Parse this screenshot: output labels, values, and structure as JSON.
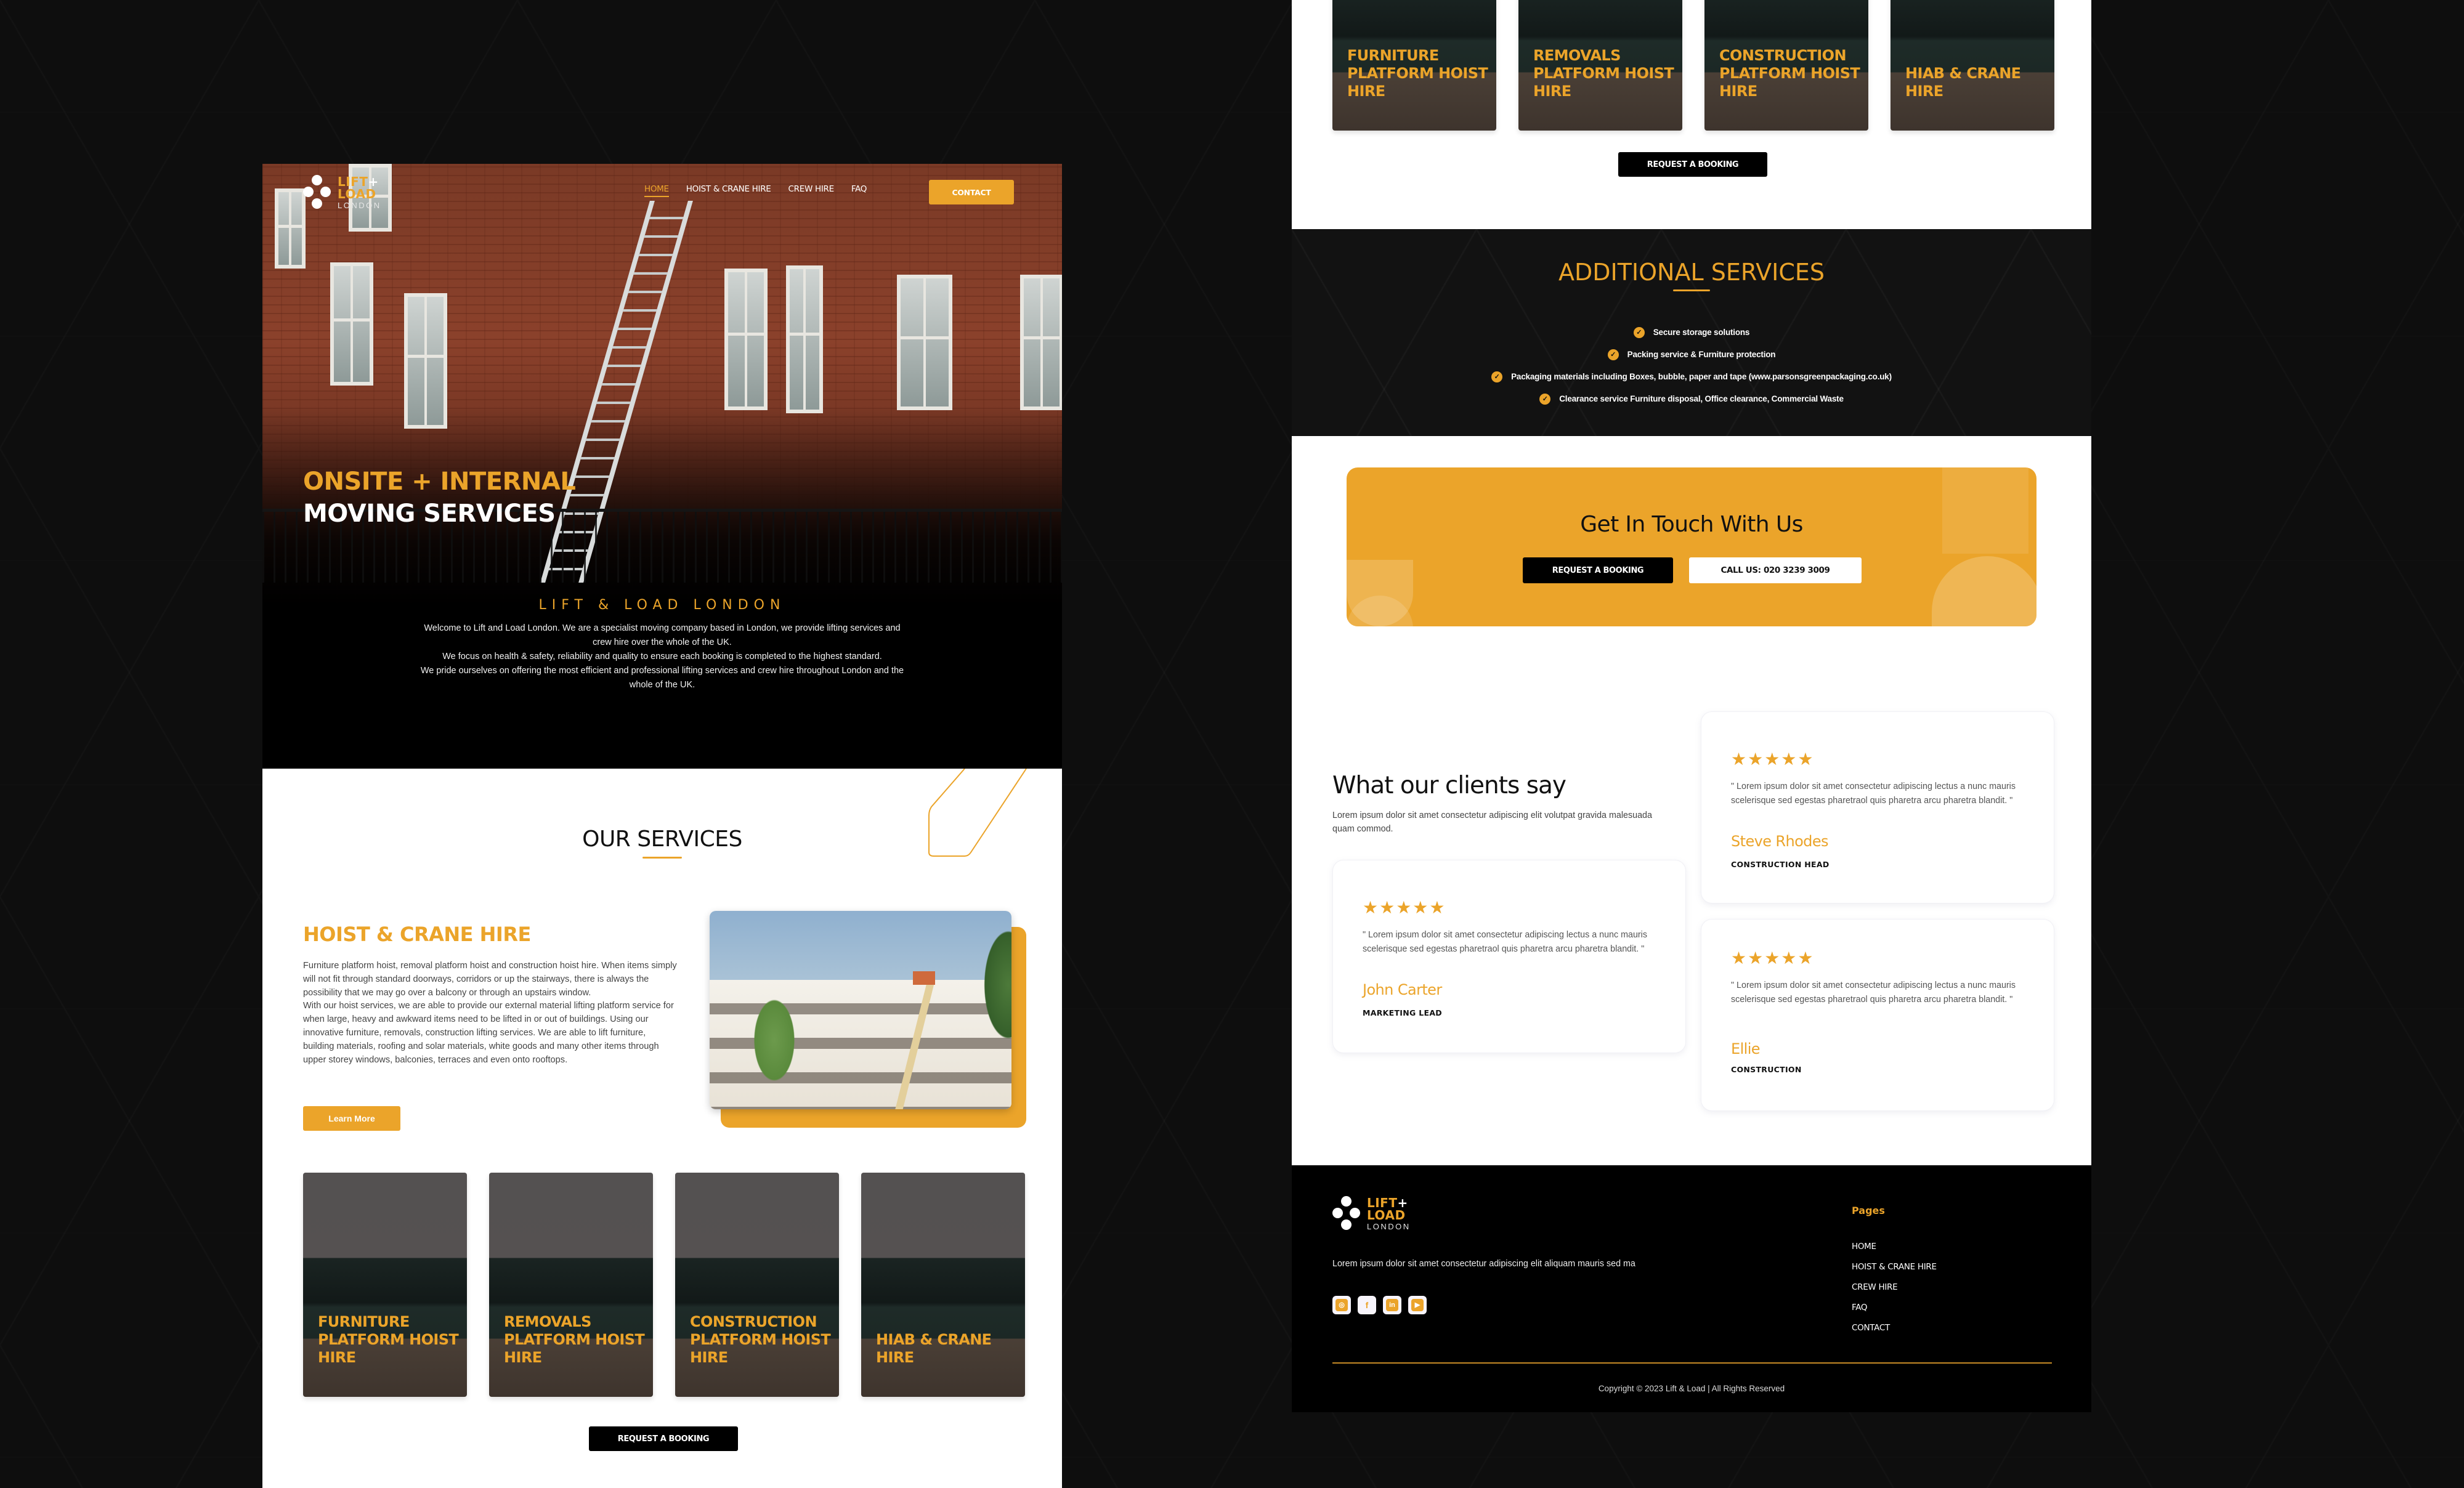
{
  "brand": {
    "logo_line1": "LIFT",
    "logo_plus": "+",
    "logo_line2": "LOAD",
    "logo_line3": "LONDON",
    "accent_color": "#eba42a"
  },
  "nav": {
    "items": [
      {
        "label": "HOME",
        "active": true
      },
      {
        "label": "HOIST & CRANE HIRE",
        "active": false
      },
      {
        "label": "CREW HIRE",
        "active": false
      },
      {
        "label": "FAQ",
        "active": false
      }
    ],
    "contact_label": "CONTACT"
  },
  "hero": {
    "title_line1": "ONSITE + INTERNAL",
    "title_line2": "MOVING SERVICES"
  },
  "intro": {
    "kicker": "LIFT & LOAD LONDON",
    "paragraphs": [
      "Welcome to Lift and Load London. We are a specialist moving company based in London, we provide lifting services and crew hire over the whole of the UK.",
      "We focus on health & safety, reliability and quality to ensure each booking is completed to the highest standard.",
      "We pride ourselves on offering the most efficient and professional lifting services and crew hire throughout London and the whole of the UK."
    ]
  },
  "services": {
    "title": "OUR SERVICES",
    "hoist": {
      "title": "HOIST & CRANE HIRE",
      "paragraphs": [
        "Furniture platform hoist, removal platform hoist and construction hoist hire. When items simply will not fit through standard doorways, corridors or up the stairways, there is always the possibility that we may go over a balcony or through an upstairs window.",
        "With our hoist services, we are able to provide our external material lifting platform service for when large, heavy and awkward items need to be lifted in or out of buildings. Using our innovative furniture, removals, construction lifting services. We are able to lift furniture, building materials, roofing and solar materials, white goods and many other items through upper storey windows, balconies, terraces and even onto rooftops."
      ],
      "learn_more_label": "Learn More"
    },
    "cards": [
      {
        "label": "FURNITURE PLATFORM HOIST HIRE"
      },
      {
        "label": "REMOVALS PLATFORM HOIST HIRE"
      },
      {
        "label": "CONSTRUCTION PLATFORM HOIST HIRE"
      },
      {
        "label": "HIAB & CRANE HIRE"
      }
    ],
    "booking_label": "REQUEST A BOOKING"
  },
  "additional": {
    "title": "ADDITIONAL SERVICES",
    "items": [
      "Secure storage solutions",
      "Packing service & Furniture protection",
      "Packaging materials including Boxes, bubble, paper and tape (www.parsonsgreenpackaging.co.uk)",
      "Clearance service Furniture disposal, Office clearance, Commercial Waste"
    ]
  },
  "cta": {
    "title": "Get In Touch With Us",
    "booking_label": "REQUEST A BOOKING",
    "call_label": "CALL US: 020 3239 3009"
  },
  "testimonials": {
    "title": "What our clients say",
    "subtitle": "Lorem ipsum dolor sit amet consectetur adipiscing elit volutpat gravida malesuada quam commod.",
    "items": [
      {
        "rating": 5,
        "stars": "★★★★★",
        "quote": "\" Lorem ipsum dolor sit amet consectetur adipiscing lectus a nunc mauris scelerisque sed egestas pharetraol quis pharetra arcu pharetra blandit. \"",
        "name": "John Carter",
        "role": "MARKETING LEAD"
      },
      {
        "rating": 5,
        "stars": "★★★★★",
        "quote": "\" Lorem ipsum dolor sit amet consectetur adipiscing lectus a nunc mauris scelerisque sed egestas pharetraol quis pharetra arcu pharetra blandit. \"",
        "name": "Steve Rhodes",
        "role": "CONSTRUCTION HEAD"
      },
      {
        "rating": 5,
        "stars": "★★★★★",
        "quote": "\" Lorem ipsum dolor sit amet consectetur adipiscing lectus a nunc mauris scelerisque sed egestas pharetraol quis pharetra arcu pharetra blandit. \"",
        "name": "Ellie",
        "role": "CONSTRUCTION"
      }
    ]
  },
  "footer": {
    "text": "Lorem ipsum dolor sit amet consectetur adipiscing elit aliquam mauris sed ma",
    "socials": [
      {
        "name": "instagram",
        "glyph": "◎"
      },
      {
        "name": "facebook",
        "glyph": "f"
      },
      {
        "name": "linkedin",
        "glyph": "in"
      },
      {
        "name": "youtube",
        "glyph": "▶"
      }
    ],
    "pages_title": "Pages",
    "pages": [
      "HOME",
      "HOIST & CRANE HIRE",
      "CREW HIRE",
      "FAQ",
      "CONTACT"
    ],
    "copyright": "Copyright © 2023 Lift & Load | All Rights Reserved"
  }
}
